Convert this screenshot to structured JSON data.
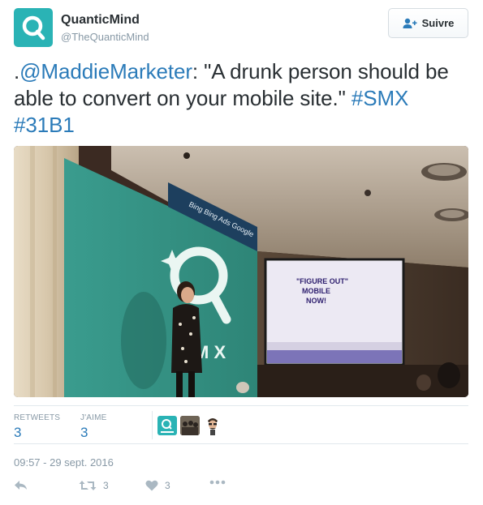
{
  "account": {
    "name": "QuanticMind",
    "handle": "@TheQuanticMind"
  },
  "follow_button": {
    "label": "Suivre"
  },
  "tweet": {
    "prefix": ".",
    "mention": "@MaddieMarketer",
    "body": ": \"A drunk person should be able to convert on your mobile site.\" ",
    "hashtag1": "#SMX",
    "hashtag2": "#31B1"
  },
  "photo": {
    "screen_text_line1": "\"FIGURE OUT\"",
    "screen_text_line2": "MOBILE",
    "screen_text_line3": "NOW!",
    "banner_letters": "M X",
    "sponsor_text": "Bing  Bing Ads  Google"
  },
  "stats": {
    "retweets_label": "RETWEETS",
    "retweets_value": "3",
    "likes_label": "J'AIME",
    "likes_value": "3"
  },
  "timestamp": "09:57 - 29 sept. 2016",
  "actions": {
    "retweet_count": "3",
    "like_count": "3"
  },
  "colors": {
    "brand_teal": "#2ab3b5",
    "link_blue": "#2b7bb9",
    "muted": "#8899a6"
  }
}
